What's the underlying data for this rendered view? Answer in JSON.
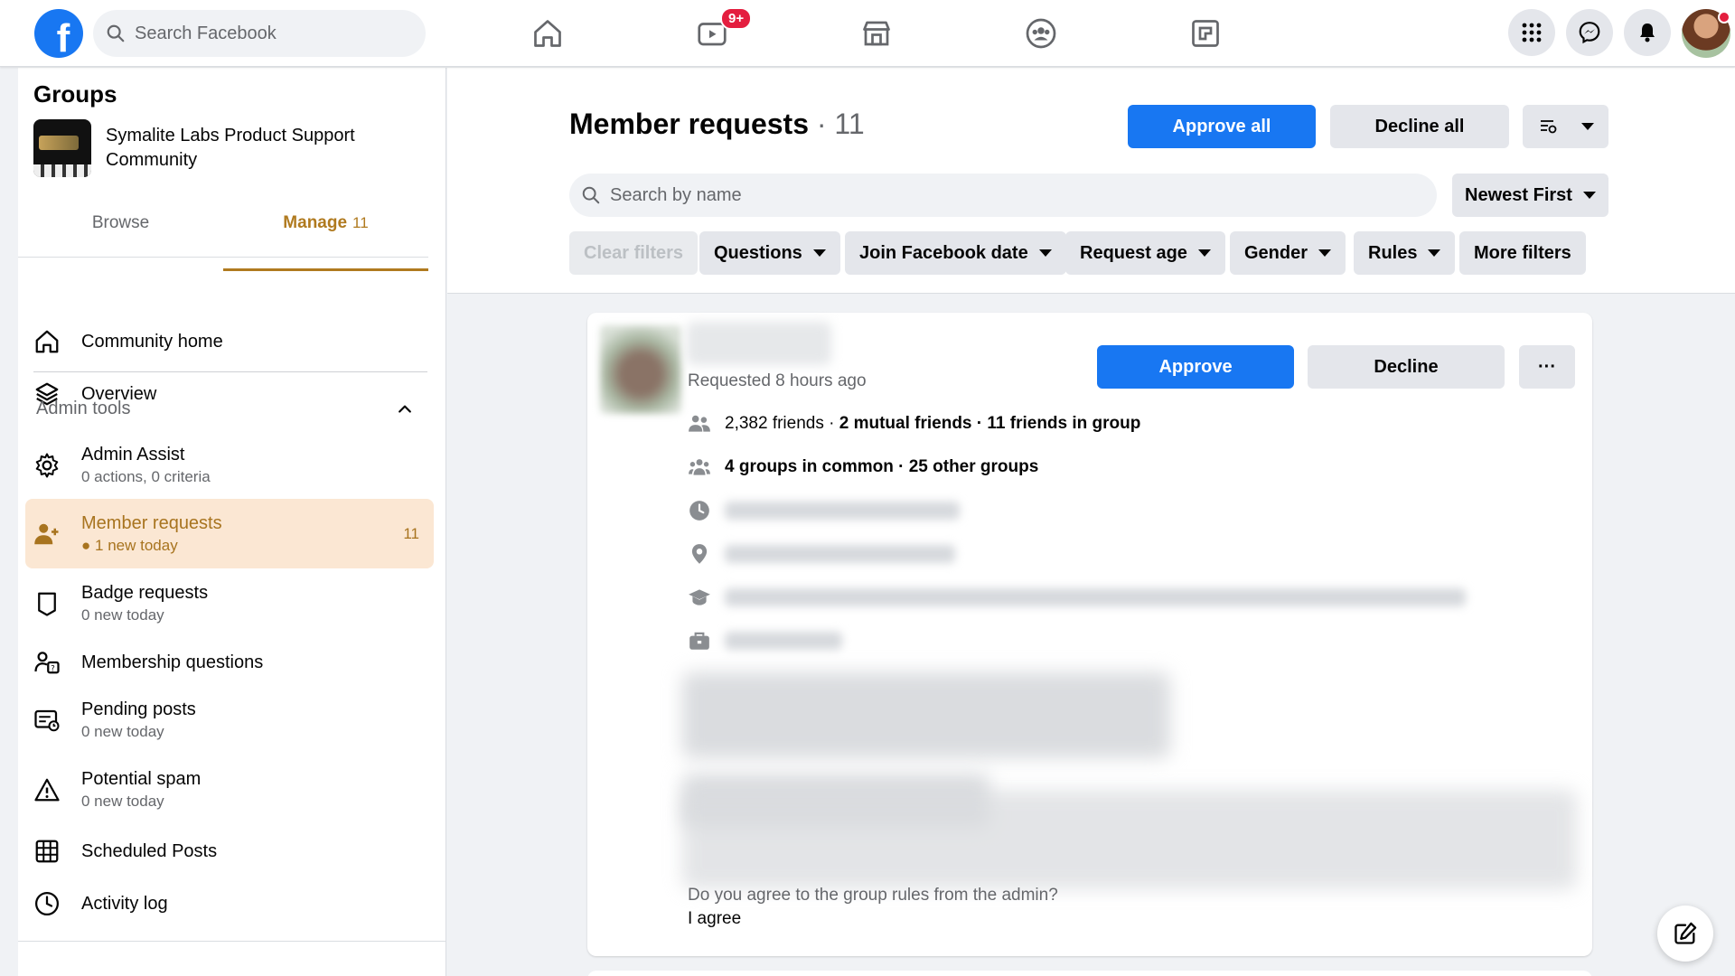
{
  "topbar": {
    "logo_letter": "f",
    "search_placeholder": "Search Facebook",
    "watch_badge": "9+"
  },
  "sidebar": {
    "title": "Groups",
    "group_name": "Symalite Labs Product Support Community",
    "tabs": [
      {
        "label": "Browse"
      },
      {
        "label": "Manage",
        "count": "11"
      }
    ],
    "top_items": [
      {
        "label": "Community home"
      },
      {
        "label": "Overview"
      }
    ],
    "admin_tools_label": "Admin tools",
    "admin_items": [
      {
        "label": "Admin Assist",
        "sub": "0 actions, 0 criteria"
      },
      {
        "label": "Member requests",
        "sub": "1 new today",
        "count": "11"
      },
      {
        "label": "Badge requests",
        "sub": "0 new today"
      },
      {
        "label": "Membership questions"
      },
      {
        "label": "Pending posts",
        "sub": "0 new today"
      },
      {
        "label": "Potential spam",
        "sub": "0 new today"
      },
      {
        "label": "Scheduled Posts"
      },
      {
        "label": "Activity log"
      }
    ]
  },
  "main": {
    "title": "Member requests",
    "title_count": "· 11",
    "approve_all": "Approve all",
    "decline_all": "Decline all",
    "search_placeholder": "Search by name",
    "sort": "Newest First",
    "filters": {
      "clear": "Clear filters",
      "questions": "Questions",
      "join_date": "Join Facebook date",
      "request_age": "Request age",
      "gender": "Gender",
      "rules": "Rules",
      "more": "More filters"
    }
  },
  "request": {
    "requested": "Requested 8 hours ago",
    "approve": "Approve",
    "decline": "Decline",
    "more": "···",
    "friends_a": "2,382 friends · ",
    "friends_b": "2 mutual friends · 11 friends in group",
    "groups": "4 groups in common · 25 other groups",
    "question": "Do you agree to the group rules from the admin?",
    "answer": "I agree"
  }
}
